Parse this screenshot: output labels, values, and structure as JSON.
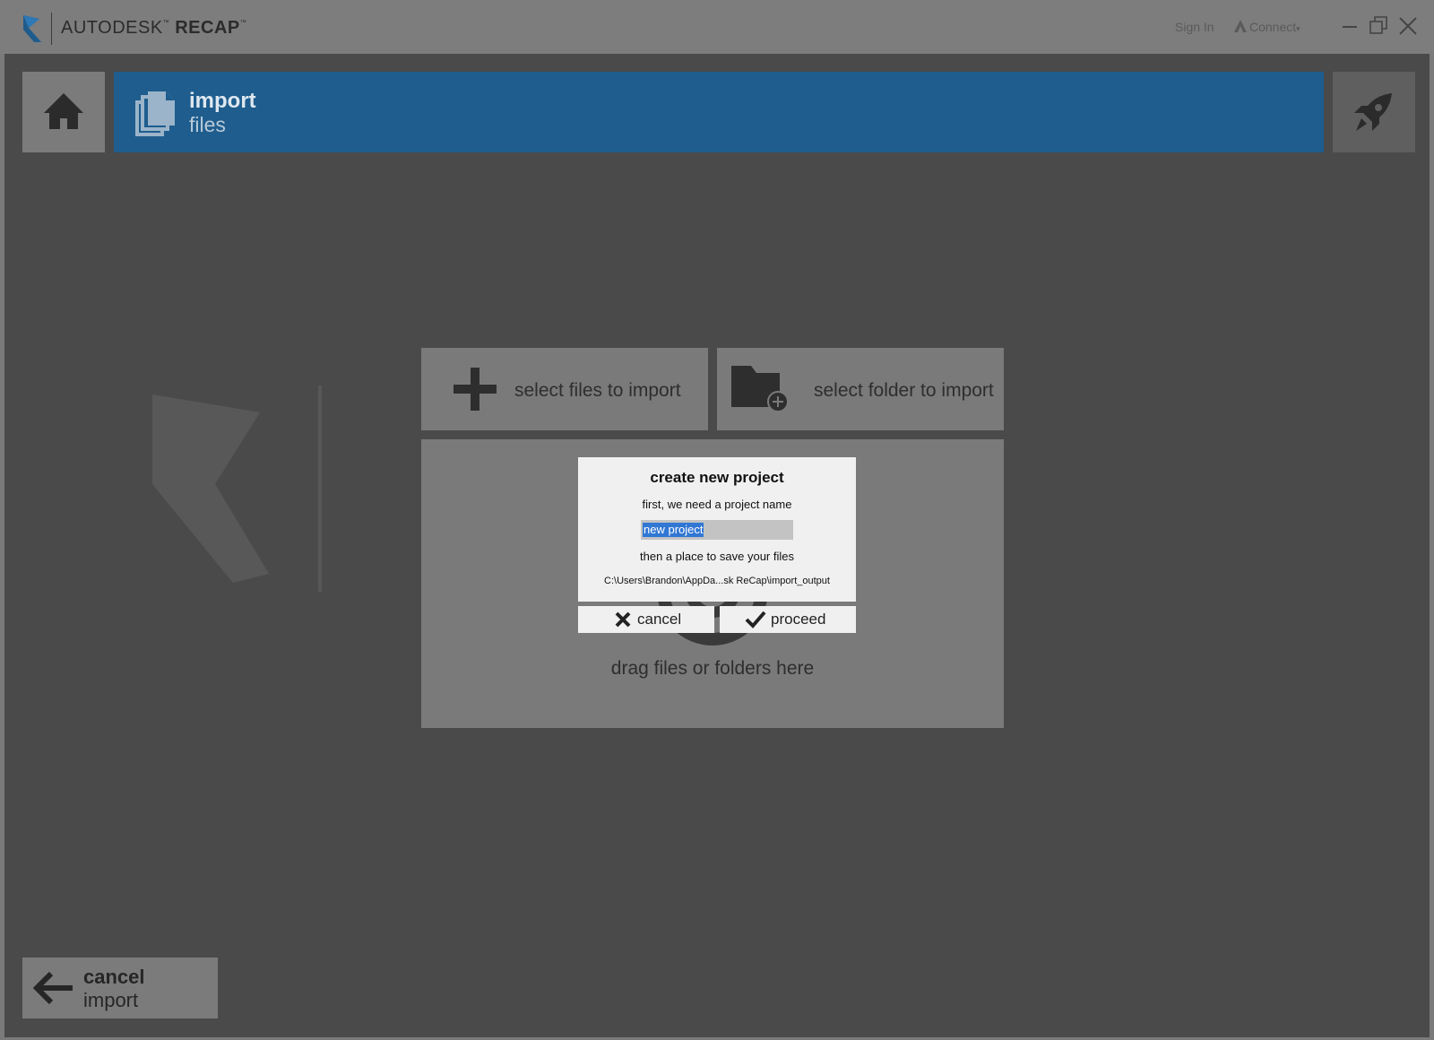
{
  "titlebar": {
    "brand": "AUTODESK",
    "product": "RECAP",
    "tm": "™",
    "sign_in": "Sign In",
    "connect": "Connect"
  },
  "header": {
    "title": "import",
    "subtitle": "files"
  },
  "tiles": {
    "select_files": "select files to import",
    "select_folder": "select folder to import",
    "drag": "drag files or folders here"
  },
  "dialog": {
    "title": "create new project",
    "prompt_name": "first, we need a project name",
    "name_value": "new project",
    "prompt_location": "then a place to save your files",
    "path": "C:\\Users\\Brandon\\AppDa...sk ReCap\\import_output",
    "cancel_label": "cancel",
    "proceed_label": "proceed"
  },
  "footer": {
    "cancel_title": "cancel",
    "cancel_sub": "import"
  },
  "colors": {
    "accent": "#1e5d8e",
    "background": "#4a4a4a",
    "tile": "#7a7a7a",
    "dialog": "#f0f0f0",
    "selection": "#3177d4"
  },
  "icons": [
    "autodesk-logo-icon",
    "home-icon",
    "import-files-icon",
    "rocket-icon",
    "plus-icon",
    "folder-add-icon",
    "target-icon",
    "close-x-icon",
    "checkmark-icon",
    "arrow-left-icon",
    "minimize-icon",
    "restore-icon",
    "close-icon"
  ]
}
